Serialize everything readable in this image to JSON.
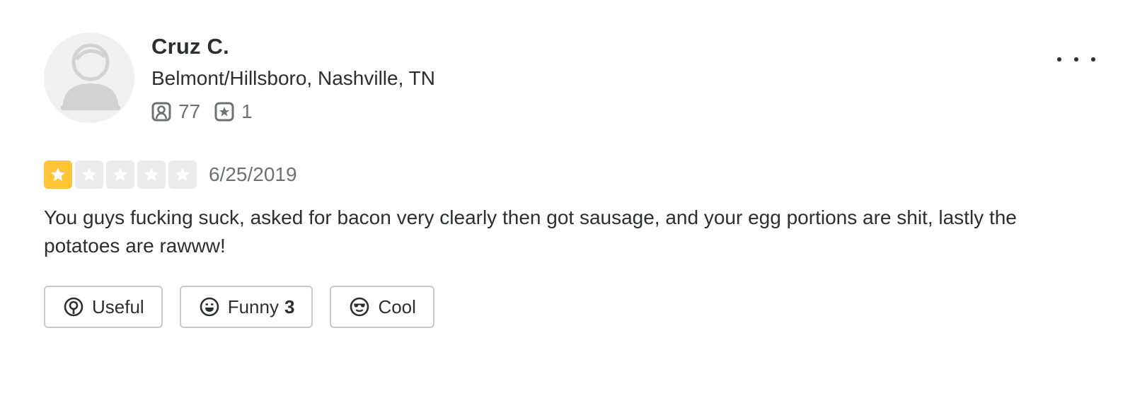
{
  "user": {
    "name": "Cruz C.",
    "location": "Belmont/Hillsboro, Nashville, TN",
    "friends_count": "77",
    "reviews_count": "1"
  },
  "review": {
    "rating": 1,
    "max_rating": 5,
    "date": "6/25/2019",
    "text": "You guys fucking suck, asked for bacon very clearly then got sausage, and your egg portions are shit, lastly the potatoes are rawww!"
  },
  "reactions": {
    "useful_label": "Useful",
    "funny_label": "Funny",
    "funny_count": "3",
    "cool_label": "Cool"
  },
  "icons": {
    "friends": "friends-icon",
    "reviews": "review-star-icon",
    "useful": "lightbulb-icon",
    "funny": "laugh-face-icon",
    "cool": "sunglasses-face-icon",
    "more": "more-options-icon"
  },
  "colors": {
    "star_filled": "#ffc536",
    "star_empty": "#ebebeb",
    "text_primary": "#2d2e2f",
    "text_secondary": "#6e7072",
    "button_border": "#c8c9ca"
  }
}
